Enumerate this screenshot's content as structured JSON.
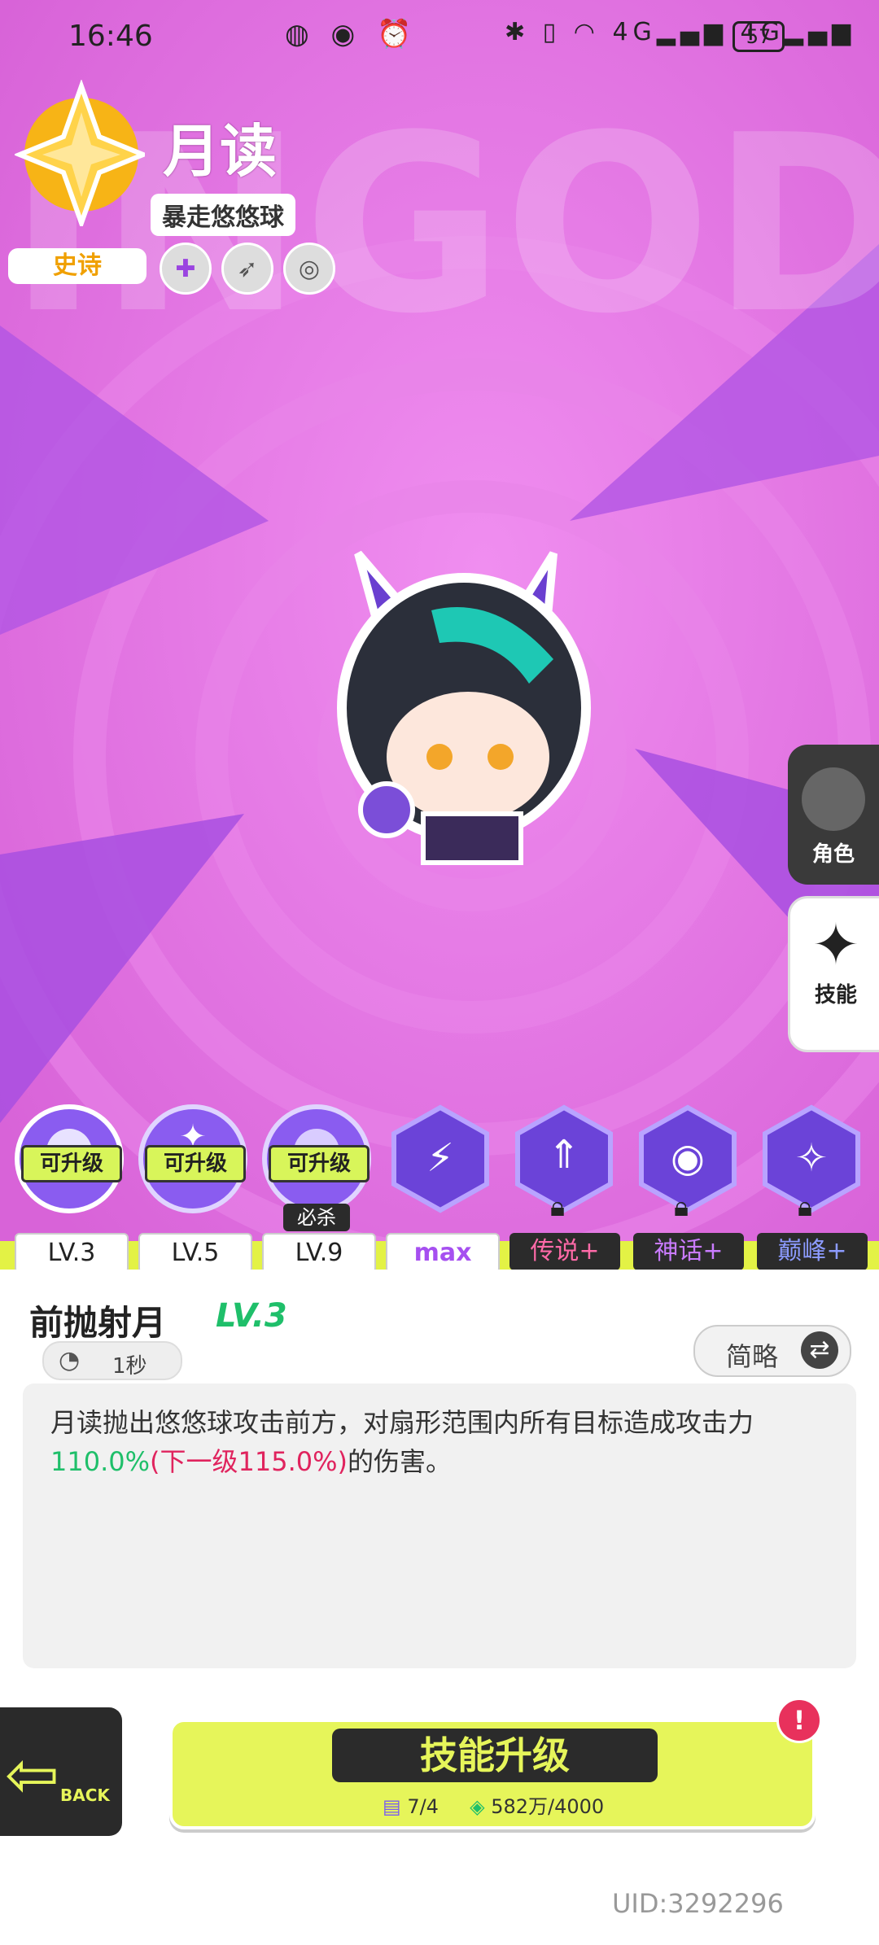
{
  "status_bar": {
    "time": "16:46",
    "battery": "57",
    "network_1": "4G",
    "network_2": "4G"
  },
  "character": {
    "name": "月读",
    "weapon": "暴走悠悠球",
    "rarity": "史诗"
  },
  "background_text": "INGOD",
  "side_tabs": [
    {
      "label": "角色"
    },
    {
      "label": "技能"
    }
  ],
  "skills": [
    {
      "badge": "可升级",
      "level": "LV.3"
    },
    {
      "badge": "可升级",
      "level": "LV.5"
    },
    {
      "badge": "可升级",
      "level": "LV.9",
      "extra": "必杀"
    },
    {
      "level": "max"
    },
    {
      "level": "传说+"
    },
    {
      "level": "神话+"
    },
    {
      "level": "巅峰+"
    }
  ],
  "skill_detail": {
    "name": "前抛射月",
    "level": "LV.3",
    "cooldown": "1秒",
    "toggle": "简略",
    "desc_prefix": "月读抛出悠悠球攻击前方，对扇形范围内所有目标造成攻击力",
    "desc_value": "110.0%",
    "desc_next": "(下一级115.0%)",
    "desc_suffix": "的伤害。"
  },
  "upgrade": {
    "label": "技能升级",
    "books": "7/4",
    "coins": "582万/4000",
    "alert": "!"
  },
  "back_label": "BACK",
  "uid": "UID:3292296",
  "colors": {
    "background": "#e47be4",
    "accent_green": "#1fbf6a",
    "accent_red": "#e0245e",
    "lime": "#e6f55a"
  }
}
